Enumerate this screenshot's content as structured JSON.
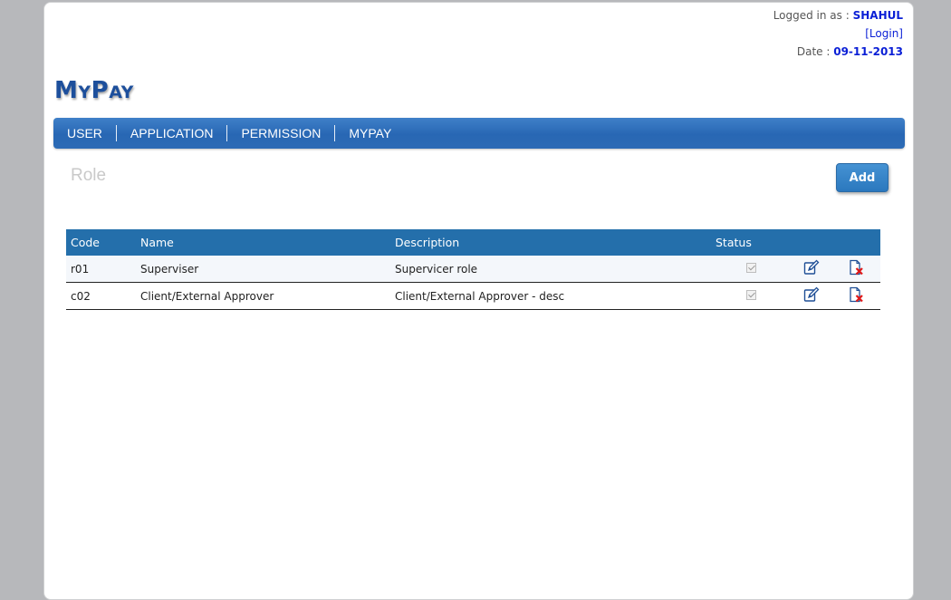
{
  "header": {
    "logged_in_label": "Logged in as : ",
    "username": "SHAHUL",
    "login_link": "[Login]",
    "date_label": "Date : ",
    "date_value": "09-11-2013"
  },
  "logo": {
    "first_big": "M",
    "first_small": "Y",
    "second_big": "P",
    "second_small": "AY"
  },
  "nav": {
    "items": [
      "USER",
      "APPLICATION",
      "PERMISSION",
      "MYPAY"
    ]
  },
  "main": {
    "title": "Role",
    "add_label": "Add",
    "table": {
      "headers": [
        "Code",
        "Name",
        "Description",
        "Status"
      ],
      "rows": [
        {
          "code": "r01",
          "name": "Superviser",
          "description": "Supervicer role",
          "status": "checked"
        },
        {
          "code": "c02",
          "name": "Client/External Approver",
          "description": "Client/External Approver - desc",
          "status": "checked"
        }
      ]
    }
  },
  "colors": {
    "nav": "#2867b4",
    "table_header": "#246fab",
    "accent_text": "#0a1fd6",
    "logo": "#1d4f9c"
  },
  "icons": {
    "edit": "edit-icon",
    "delete": "delete-icon"
  }
}
